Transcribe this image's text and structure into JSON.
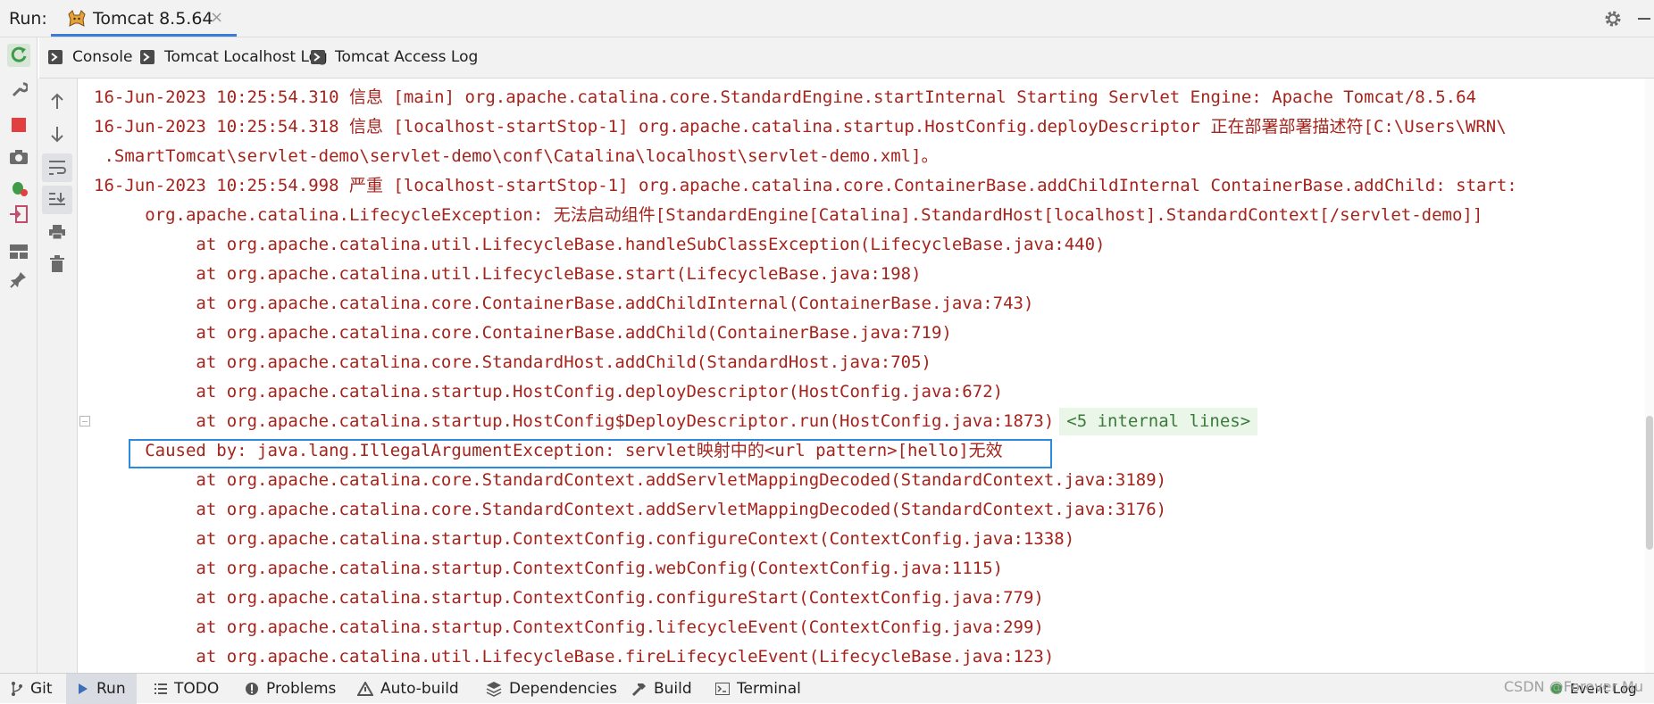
{
  "header": {
    "run_label": "Run:",
    "tab_title": "Tomcat 8.5.64",
    "close_glyph": "×"
  },
  "subtabs": [
    {
      "label": "Console"
    },
    {
      "label": "Tomcat Localhost Log"
    },
    {
      "label": "Tomcat Access Log"
    }
  ],
  "console_lines": [
    "16-Jun-2023 10:25:54.310 信息 [main] org.apache.catalina.core.StandardEngine.startInternal Starting Servlet Engine: Apache Tomcat/8.5.64",
    "16-Jun-2023 10:25:54.318 信息 [localhost-startStop-1] org.apache.catalina.startup.HostConfig.deployDescriptor 正在部署部署描述符[C:\\Users\\WRN\\",
    " .SmartTomcat\\servlet-demo\\servlet-demo\\conf\\Catalina\\localhost\\servlet-demo.xml]。",
    "16-Jun-2023 10:25:54.998 严重 [localhost-startStop-1] org.apache.catalina.core.ContainerBase.addChildInternal ContainerBase.addChild: start:",
    "     org.apache.catalina.LifecycleException: 无法启动组件[StandardEngine[Catalina].StandardHost[localhost].StandardContext[/servlet-demo]]",
    "          at org.apache.catalina.util.LifecycleBase.handleSubClassException(LifecycleBase.java:440)",
    "          at org.apache.catalina.util.LifecycleBase.start(LifecycleBase.java:198)",
    "          at org.apache.catalina.core.ContainerBase.addChildInternal(ContainerBase.java:743)",
    "          at org.apache.catalina.core.ContainerBase.addChild(ContainerBase.java:719)",
    "          at org.apache.catalina.core.StandardHost.addChild(StandardHost.java:705)",
    "          at org.apache.catalina.startup.HostConfig.deployDescriptor(HostConfig.java:672)",
    "          at org.apache.catalina.startup.HostConfig$DeployDescriptor.run(HostConfig.java:1873)",
    "     Caused by: java.lang.IllegalArgumentException: servlet映射中的<url pattern>[hello]无效",
    "          at org.apache.catalina.core.StandardContext.addServletMappingDecoded(StandardContext.java:3189)",
    "          at org.apache.catalina.core.StandardContext.addServletMappingDecoded(StandardContext.java:3176)",
    "          at org.apache.catalina.startup.ContextConfig.configureContext(ContextConfig.java:1338)",
    "          at org.apache.catalina.startup.ContextConfig.webConfig(ContextConfig.java:1115)",
    "          at org.apache.catalina.startup.ContextConfig.configureStart(ContextConfig.java:779)",
    "          at org.apache.catalina.startup.ContextConfig.lifecycleEvent(ContextConfig.java:299)",
    "          at org.apache.catalina.util.LifecycleBase.fireLifecycleEvent(LifecycleBase.java:123)"
  ],
  "internal_lines_label": "<5 internal lines>",
  "bottom_tabs": [
    {
      "label": "Git",
      "icon": "git-branch-icon"
    },
    {
      "label": "Run",
      "icon": "run-icon"
    },
    {
      "label": "TODO",
      "icon": "todo-icon"
    },
    {
      "label": "Problems",
      "icon": "problems-icon"
    },
    {
      "label": "Auto-build",
      "icon": "warning-icon"
    },
    {
      "label": "Dependencies",
      "icon": "dependencies-icon"
    },
    {
      "label": "Build",
      "icon": "hammer-icon"
    },
    {
      "label": "Terminal",
      "icon": "terminal-icon"
    }
  ],
  "watermark": "CSDN @Forever Mu",
  "event_log_label": "Event Log",
  "colors": {
    "error_text": "#a4231c",
    "accent_blue": "#3d7bd9",
    "highlight_border": "#2a8be0",
    "internal_bg": "#e9f6e8"
  }
}
